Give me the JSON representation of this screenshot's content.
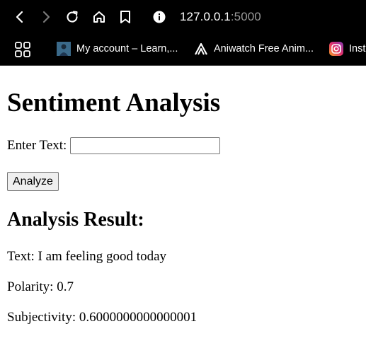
{
  "browser": {
    "url_host": "127.0.0.1",
    "url_port": ":5000",
    "bookmarks": [
      {
        "label": "My account – Learn,...",
        "icon": "account-avatar-icon"
      },
      {
        "label": "Aniwatch Free Anim...",
        "icon": "aniwatch-logo-icon"
      },
      {
        "label": "Inst",
        "icon": "instagram-icon"
      }
    ],
    "icons": {
      "back": "back-arrow-icon",
      "forward": "forward-arrow-icon",
      "reload": "reload-icon",
      "home": "home-icon",
      "bookmark": "bookmark-icon",
      "info": "info-icon",
      "apps": "apps-grid-icon"
    }
  },
  "page": {
    "title": "Sentiment Analysis",
    "input_label": "Enter Text:",
    "input_value": "",
    "analyze_button": "Analyze",
    "result_heading": "Analysis Result:",
    "result_text": "Text: I am feeling good today",
    "result_polarity": "Polarity: 0.7",
    "result_subjectivity": "Subjectivity: 0.6000000000000001"
  }
}
